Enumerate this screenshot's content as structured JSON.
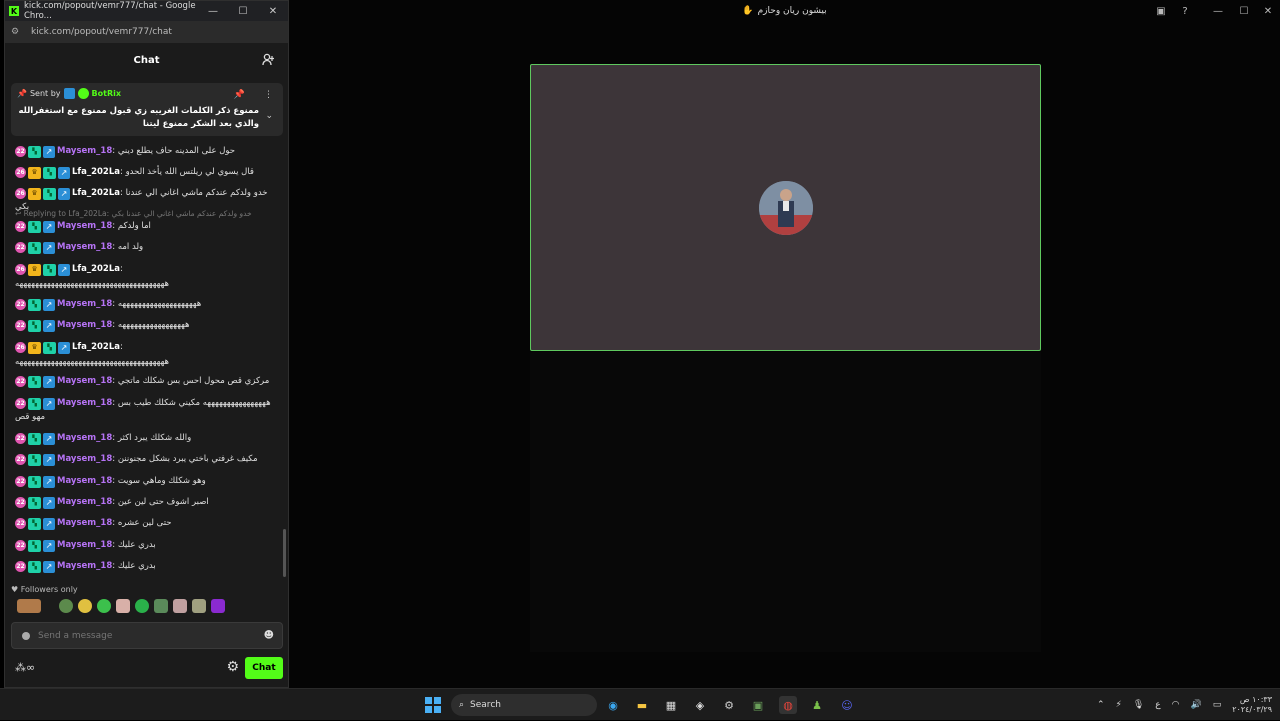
{
  "chrome": {
    "window_title": "kick.com/popout/vemr777/chat - Google Chro...",
    "url": "kick.com/popout/vemr777/chat"
  },
  "background_window": {
    "title": "بيشون ريان وحازم"
  },
  "chat": {
    "header_title": "Chat",
    "pinned": {
      "sent_by_label": "Sent by",
      "user": "BotRix",
      "text": "ممنوع ذكر الكلمات الغريبه زي قبول ممنوع مع استغفرالله والذي بعد الشكر ممنوع ليتنا"
    },
    "messages": [
      {
        "user": "Maysem_18",
        "sub": "22",
        "badges": "og-arrow",
        "text": "حول على المدينه حاف يطلع ديني"
      },
      {
        "user": "Lfa_202La",
        "sub": "26",
        "badges": "crown-og-arrow",
        "text": "قال يسوي لي ريلتس الله يأخذ الحدو"
      },
      {
        "user": "Lfa_202La",
        "sub": "26",
        "badges": "crown-og-arrow",
        "text": "خدو ولدكم عندكم ماشي اغاني الي عندنا بكي"
      },
      {
        "reply": "Replying to Lfa_202La: خدو ولدكم عندكم ماشي اغاني الي عندنا بكي"
      },
      {
        "user": "Maysem_18",
        "sub": "22",
        "badges": "og-arrow",
        "text": "اما ولدكم"
      },
      {
        "user": "Maysem_18",
        "sub": "22",
        "badges": "og-arrow",
        "text": "ولد امه"
      },
      {
        "user": "Lfa_202La",
        "sub": "26",
        "badges": "crown-og-arrow",
        "text": ""
      },
      {
        "cont": "ههههههههههههههههههههههههههههههههههههههه"
      },
      {
        "user": "Maysem_18",
        "sub": "22",
        "badges": "og-arrow",
        "text": "ههههههههههههههههههههه"
      },
      {
        "user": "Maysem_18",
        "sub": "22",
        "badges": "og-arrow",
        "text": "هههههههههههههههههه"
      },
      {
        "user": "Lfa_202La",
        "sub": "26",
        "badges": "crown-og-arrow",
        "text": ""
      },
      {
        "cont": "ههههههههههههههههههههههههههههههههههههههه"
      },
      {
        "user": "Maysem_18",
        "sub": "22",
        "badges": "og-arrow",
        "text": "مركزي قص محول احس بس شكلك ماتجي"
      },
      {
        "user": "Maysem_18",
        "sub": "22",
        "badges": "og-arrow",
        "text": "ههههههههههههههههه مكيني شكلك طيب بس"
      },
      {
        "cont": "مهو قص"
      },
      {
        "user": "Maysem_18",
        "sub": "22",
        "badges": "og-arrow",
        "text": "والله شكلك يبرد اكثر"
      },
      {
        "user": "Maysem_18",
        "sub": "22",
        "badges": "og-arrow",
        "text": "مكيف غرفتي باختي يبرد بشكل مجنوننن"
      },
      {
        "user": "Maysem_18",
        "sub": "22",
        "badges": "og-arrow",
        "text": "وهو شكلك وماهي سويت"
      },
      {
        "user": "Maysem_18",
        "sub": "22",
        "badges": "og-arrow",
        "text": "اصبر اشوف حتى لين عين"
      },
      {
        "user": "Maysem_18",
        "sub": "22",
        "badges": "og-arrow",
        "text": "حتى لين عشره"
      },
      {
        "user": "Maysem_18",
        "sub": "22",
        "badges": "og-arrow",
        "text": "بدري عليك"
      },
      {
        "user": "Maysem_18",
        "sub": "22",
        "badges": "og-arrow",
        "text": "بدري عليك"
      }
    ],
    "followers_only_label": "Followers only",
    "input_placeholder": "Send a message",
    "chat_button": "Chat"
  },
  "taskbar": {
    "search_label": "Search",
    "tray_lang": "ع",
    "clock_time": "١٠:٣٣ ص",
    "clock_date": "٢٠٢٤/٠٣/٢٩"
  },
  "colors": {
    "kick_green": "#53fc18",
    "video_border": "#5fc95f",
    "username_purple": "#b673f5",
    "sub_badge": "#e056b0"
  }
}
